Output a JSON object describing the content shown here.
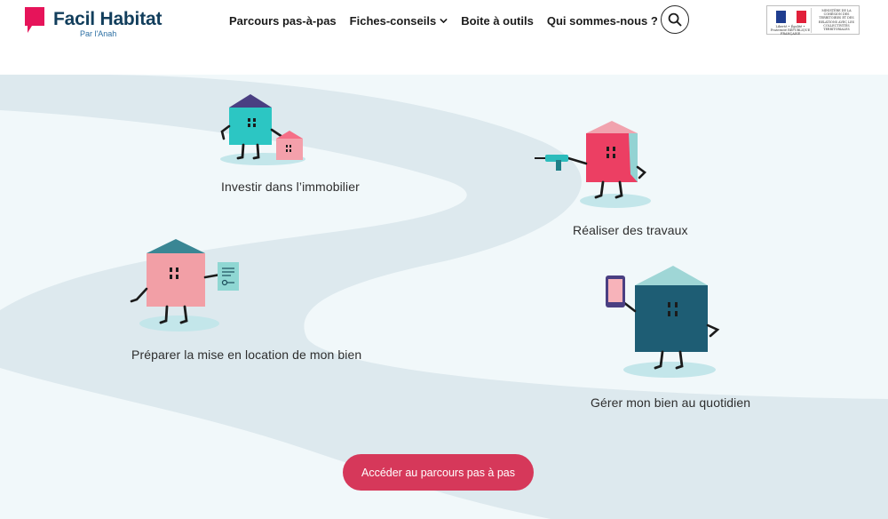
{
  "brand": {
    "name": "Facil Habitat",
    "subtitle": "Par l'Anah"
  },
  "nav": {
    "items": [
      {
        "label": "Parcours pas-à-pas"
      },
      {
        "label": "Fiches-conseils"
      },
      {
        "label": "Boite à outils"
      },
      {
        "label": "Qui sommes-nous ?"
      }
    ]
  },
  "ministry": {
    "republic": "Liberté • Égalité • Fraternité RÉPUBLIQUE FRANÇAISE",
    "text": "Ministère de la cohésion des territoires et des relations avec les collectivités territoriales"
  },
  "steps": [
    {
      "label": "Investir dans l’immobilier"
    },
    {
      "label": "Réaliser des travaux"
    },
    {
      "label": "Préparer la mise en location de mon bien"
    },
    {
      "label": "Gérer mon bien au quotidien"
    }
  ],
  "cta": {
    "label": "Accéder au parcours pas à pas"
  },
  "icons": [
    "logo-speech-bubble-icon",
    "chevron-down-icon",
    "search-icon",
    "drill-icon",
    "key-document-icon",
    "smartphone-icon"
  ],
  "colors": {
    "brand_pink": "#e6145a",
    "brand_navy": "#123e5c",
    "cta": "#d6385a",
    "background": "#f1f8fa",
    "road": "#dde9ee"
  }
}
